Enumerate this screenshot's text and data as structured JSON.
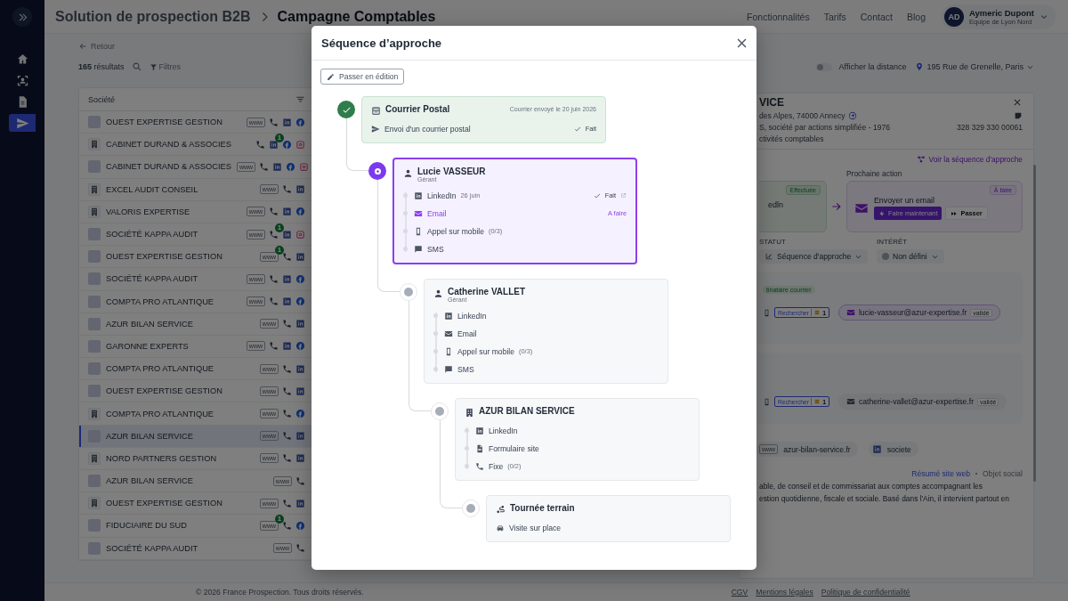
{
  "sidebar": {
    "items": [
      {
        "kind": "home",
        "selected": false
      },
      {
        "kind": "team",
        "selected": false
      },
      {
        "kind": "document",
        "selected": false
      },
      {
        "kind": "send",
        "selected": true
      }
    ]
  },
  "header": {
    "breadcrumb": [
      "Solution de prospection B2B",
      "Campagne Comptables"
    ],
    "nav": [
      "Fonctionnalités",
      "Tarifs",
      "Contact",
      "Blog"
    ],
    "user": {
      "initials": "AD",
      "name": "Aymeric Dupont",
      "team": "Equipe de Lyon Nord"
    }
  },
  "back_link": "Retour",
  "toolbar": {
    "count": "165",
    "count_label": "résultats",
    "filters": "Filtres",
    "distance_toggle": {
      "label": "Afficher la distance",
      "on": false
    },
    "address": "195 Rue de Grenelle, Paris"
  },
  "table": {
    "column": "Société",
    "rows": [
      {
        "name": "OUEST EXPERTISE GESTION",
        "kind": "image",
        "selected": false,
        "links": [
          {
            "kind": "www",
            "label": "www"
          },
          {
            "kind": "phone"
          },
          {
            "kind": "linkedin"
          },
          {
            "kind": "facebook"
          }
        ]
      },
      {
        "name": "CABINET DURAND & ASSOCIES",
        "kind": "building",
        "selected": false,
        "links": [
          {
            "kind": "phone"
          },
          {
            "kind": "linkedin",
            "badge": "1"
          },
          {
            "kind": "facebook"
          },
          {
            "kind": "instagram"
          }
        ]
      },
      {
        "name": "CABINET DURAND & ASSOCIES",
        "kind": "image",
        "selected": false,
        "links": [
          {
            "kind": "www",
            "label": "www"
          },
          {
            "kind": "phone"
          },
          {
            "kind": "linkedin"
          },
          {
            "kind": "facebook"
          },
          {
            "kind": "instagram"
          }
        ]
      },
      {
        "name": "EXCEL AUDIT CONSEIL",
        "kind": "building",
        "selected": false,
        "links": [
          {
            "kind": "www",
            "label": "www"
          },
          {
            "kind": "phone"
          },
          {
            "kind": "linkedin"
          }
        ]
      },
      {
        "name": "VALORIS EXPERTISE",
        "kind": "building",
        "selected": false,
        "links": [
          {
            "kind": "www",
            "label": "www"
          },
          {
            "kind": "phone"
          },
          {
            "kind": "linkedin"
          },
          {
            "kind": "facebook"
          }
        ]
      },
      {
        "name": "SOCIÉTÉ KAPPA AUDIT",
        "kind": "image",
        "selected": false,
        "links": [
          {
            "kind": "www",
            "label": "www"
          },
          {
            "kind": "phone",
            "badge": "1"
          },
          {
            "kind": "linkedin"
          },
          {
            "kind": "instagram"
          }
        ]
      },
      {
        "name": "OUEST EXPERTISE GESTION",
        "kind": "image",
        "selected": false,
        "links": [
          {
            "kind": "www",
            "label": "www",
            "badge": "1"
          },
          {
            "kind": "phone"
          },
          {
            "kind": "linkedin"
          }
        ]
      },
      {
        "name": "SOCIÉTÉ KAPPA AUDIT",
        "kind": "image",
        "selected": false,
        "links": [
          {
            "kind": "www",
            "label": "www"
          },
          {
            "kind": "phone"
          },
          {
            "kind": "linkedin"
          },
          {
            "kind": "facebook"
          }
        ]
      },
      {
        "name": "COMPTA PRO ATLANTIQUE",
        "kind": "image",
        "selected": false,
        "links": [
          {
            "kind": "www",
            "label": "www"
          },
          {
            "kind": "phone"
          },
          {
            "kind": "linkedin"
          },
          {
            "kind": "facebook"
          }
        ]
      },
      {
        "name": "AZUR BILAN SERVICE",
        "kind": "image",
        "selected": false,
        "links": [
          {
            "kind": "www",
            "label": "www"
          },
          {
            "kind": "phone"
          },
          {
            "kind": "linkedin"
          }
        ]
      },
      {
        "name": "GARONNE EXPERTS",
        "kind": "image",
        "selected": false,
        "links": [
          {
            "kind": "www",
            "label": "www"
          },
          {
            "kind": "phone"
          },
          {
            "kind": "linkedin"
          },
          {
            "kind": "facebook"
          }
        ]
      },
      {
        "name": "COMPTA PRO ATLANTIQUE",
        "kind": "image",
        "selected": false,
        "links": [
          {
            "kind": "www",
            "label": "www"
          },
          {
            "kind": "phone"
          },
          {
            "kind": "linkedin"
          }
        ]
      },
      {
        "name": "OUEST EXPERTISE GESTION",
        "kind": "image",
        "selected": false,
        "links": [
          {
            "kind": "www",
            "label": "www"
          },
          {
            "kind": "phone"
          },
          {
            "kind": "linkedin"
          }
        ]
      },
      {
        "name": "COMPTA PRO ATLANTIQUE",
        "kind": "building",
        "selected": false,
        "links": [
          {
            "kind": "www",
            "label": "www"
          },
          {
            "kind": "phone"
          },
          {
            "kind": "facebook"
          }
        ]
      },
      {
        "name": "AZUR BILAN SERVICE",
        "kind": "image",
        "selected": true,
        "links": [
          {
            "kind": "www",
            "label": "www"
          },
          {
            "kind": "phone"
          },
          {
            "kind": "linkedin"
          }
        ]
      },
      {
        "name": "NORD PARTNERS GESTION",
        "kind": "building",
        "selected": false,
        "links": [
          {
            "kind": "www",
            "label": "www"
          },
          {
            "kind": "phone"
          },
          {
            "kind": "linkedin"
          }
        ]
      },
      {
        "name": "AZUR BILAN SERVICE",
        "kind": "image",
        "selected": false,
        "links": [
          {
            "kind": "www",
            "label": "www"
          },
          {
            "kind": "phone"
          }
        ]
      },
      {
        "name": "OUEST EXPERTISE GESTION",
        "kind": "building",
        "selected": false,
        "links": [
          {
            "kind": "www",
            "label": "www"
          },
          {
            "kind": "phone"
          },
          {
            "kind": "linkedin"
          }
        ]
      },
      {
        "name": "FIDUCIAIRE DU SUD",
        "kind": "image",
        "selected": false,
        "links": [
          {
            "kind": "www",
            "label": "www",
            "badge": "1"
          },
          {
            "kind": "phone"
          },
          {
            "kind": "facebook"
          }
        ]
      },
      {
        "name": "SOCIÉTÉ KAPPA AUDIT",
        "kind": "image",
        "selected": false,
        "links": [
          {
            "kind": "www",
            "label": "www"
          },
          {
            "kind": "phone"
          }
        ]
      }
    ]
  },
  "detail": {
    "title": "VICE",
    "address": "des Alpes, 74000 Annecy",
    "legal": "S, société par actions simplifiée - 1976",
    "siret": "328 329 330 00061",
    "activity": "ctivités comptables",
    "sequence_link": "Voir la séquence d'approche",
    "next_action_label": "Prochaine action",
    "last_action": {
      "badge": "Effectuée",
      "label": "edln"
    },
    "next_action": {
      "badge": "À faire",
      "label": "Envoyer un email",
      "primary_button": "Faire maintenant",
      "secondary_button": "Passer"
    },
    "status": {
      "label": "STATUT",
      "value": "Séquence d'approche"
    },
    "interest": {
      "label": "INTÉRÊT",
      "value": "Non défini"
    },
    "contacts": [
      {
        "tag": "tinataire courrier",
        "search_button": "Rechercher",
        "credits": "1",
        "email": "lucie-vasseur@azur-expertise.fr",
        "email_status": "validé",
        "selected": true
      },
      {
        "search_button": "Rechercher",
        "credits": "1",
        "email": "catherine-vallet@azur-expertise.fr",
        "email_status": "validé",
        "selected": false
      }
    ],
    "website": {
      "tag": "www",
      "url": "azur-bilan-service.fr"
    },
    "linkedin": "societe",
    "summary_tabs": [
      {
        "label": "Résumé site web",
        "selected": true
      },
      {
        "label": "Objet social",
        "selected": false
      }
    ],
    "summary_lines": [
      "able, de conseil et de commissariat aux comptes accompagnant les",
      "estion quotidienne, fiscale et sociale. Basé dans l'Ain, il intervient partout en"
    ]
  },
  "footer": {
    "copyright": "© 2026 France Prospection. Tous droits réservés.",
    "links": [
      "CGV",
      "Mentions légales",
      "Politique de confidentialité"
    ]
  },
  "modal": {
    "title": "Séquence d’approche",
    "edit_button": "Passer en édition",
    "steps": [
      {
        "kind": "postal",
        "done": true,
        "current": false,
        "title": "Courrier Postal",
        "meta": "Courrier envoyé le 20 juin 2026",
        "actions": [
          {
            "kind": "letter",
            "label": "Envoi d'un courrier postal",
            "done": true,
            "active": false,
            "status": "Fait"
          }
        ]
      },
      {
        "kind": "person",
        "done": false,
        "current": true,
        "title": "Lucie VASSEUR",
        "role": "Gérant",
        "actions": [
          {
            "kind": "linkedin",
            "label": "LinkedIn",
            "date": "26 juin",
            "done": true,
            "active": false,
            "status": "Fait",
            "external": true
          },
          {
            "kind": "email",
            "label": "Email",
            "done": false,
            "active": true,
            "status": "A faire"
          },
          {
            "kind": "mobile",
            "label": "Appel sur mobile",
            "count": "(0/3)",
            "done": false,
            "active": false
          },
          {
            "kind": "sms",
            "label": "SMS",
            "done": false,
            "active": false
          }
        ]
      },
      {
        "kind": "person",
        "done": false,
        "current": false,
        "title": "Catherine VALLET",
        "role": "Gérant",
        "actions": [
          {
            "kind": "linkedin",
            "label": "LinkedIn",
            "done": false,
            "active": false
          },
          {
            "kind": "email",
            "label": "Email",
            "done": false,
            "active": false
          },
          {
            "kind": "mobile",
            "label": "Appel sur mobile",
            "count": "(0/3)",
            "done": false,
            "active": false
          },
          {
            "kind": "sms",
            "label": "SMS",
            "done": false,
            "active": false
          }
        ]
      },
      {
        "kind": "company",
        "done": false,
        "current": false,
        "title": "AZUR BILAN SERVICE",
        "actions": [
          {
            "kind": "linkedin",
            "label": "LinkedIn",
            "done": false,
            "active": false
          },
          {
            "kind": "form",
            "label": "Formulaire site",
            "done": false,
            "active": false
          },
          {
            "kind": "landline",
            "label": "Fixe",
            "count": "(0/2)",
            "done": false,
            "active": false
          }
        ]
      },
      {
        "kind": "field",
        "done": false,
        "current": false,
        "title": "Tournée terrain",
        "actions": [
          {
            "kind": "visit",
            "label": "Visite sur place",
            "done": false,
            "active": false
          }
        ]
      }
    ]
  }
}
